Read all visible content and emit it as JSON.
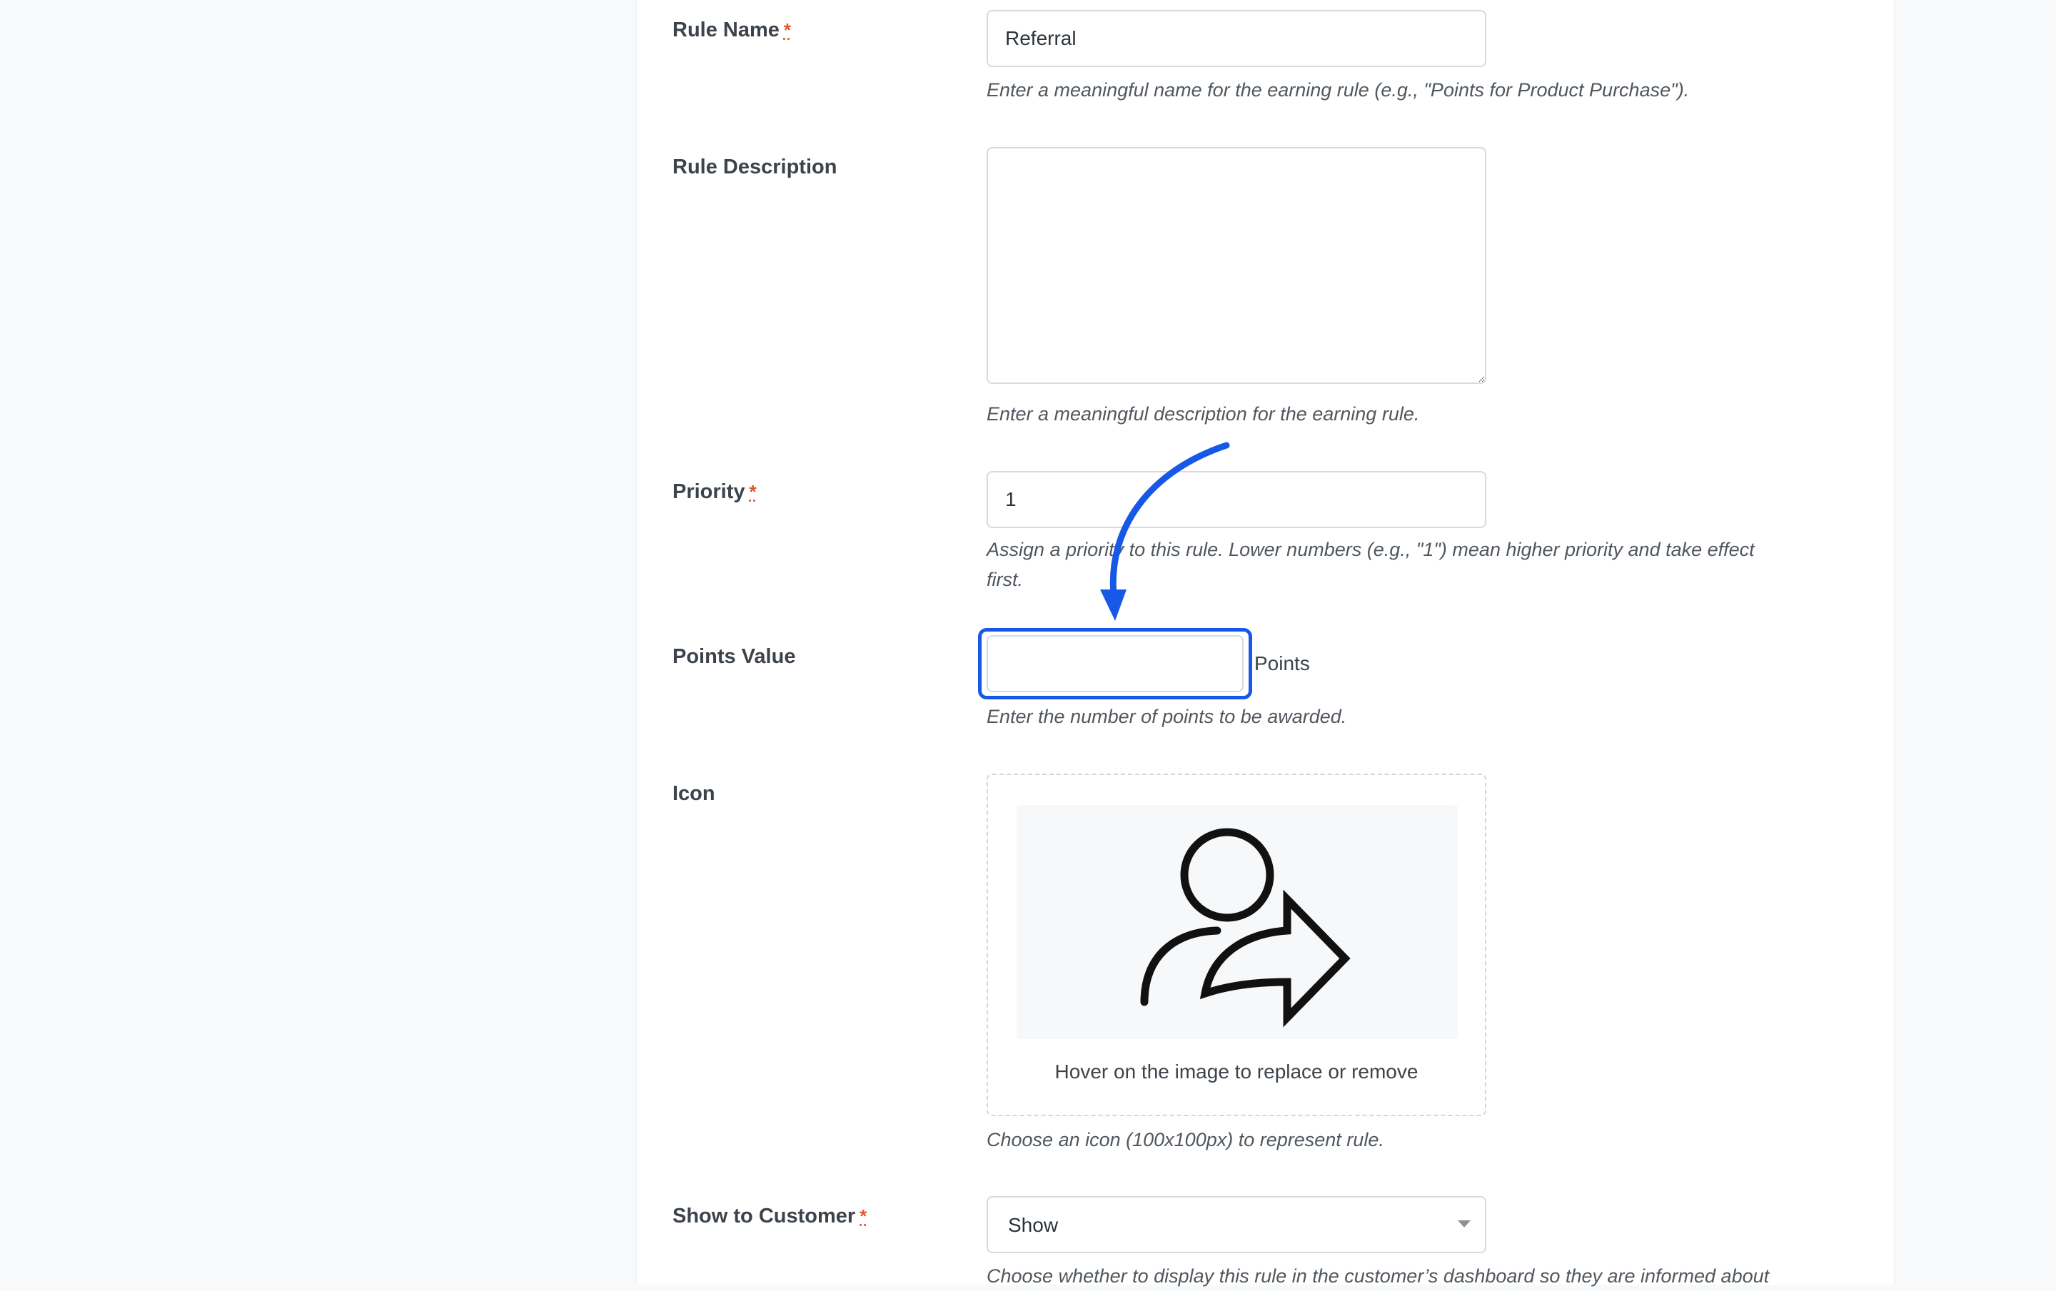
{
  "form": {
    "rule_name": {
      "label": "Rule Name",
      "required_mark": "*",
      "value": "Referral",
      "help": "Enter a meaningful name for the earning rule (e.g., \"Points for Product Purchase\")."
    },
    "rule_description": {
      "label": "Rule Description",
      "value": "",
      "help": "Enter a meaningful description for the earning rule."
    },
    "priority": {
      "label": "Priority",
      "required_mark": "*",
      "value": "1",
      "help_line1": "Assign a priority to this rule. Lower numbers (e.g., \"1\") mean higher priority and take effect",
      "help_line2": "first."
    },
    "points_value": {
      "label": "Points Value",
      "value": "",
      "suffix": "Points",
      "help": "Enter the number of points to be awarded."
    },
    "icon": {
      "label": "Icon",
      "image_icon": "user-share-icon",
      "caption": "Hover on the image to replace or remove",
      "help": "Choose an icon (100x100px) to represent rule."
    },
    "show_to_customer": {
      "label": "Show to Customer",
      "required_mark": "*",
      "selected": "Show",
      "help": "Choose whether to display this rule in the customer’s dashboard so they are informed about"
    }
  },
  "annotation": {
    "arrow_color": "#1759e6",
    "highlight_color": "#1759e6"
  },
  "colors": {
    "required": "#e0562b",
    "label": "#3c434a",
    "help_text": "#50575e",
    "border": "#d7dade"
  }
}
